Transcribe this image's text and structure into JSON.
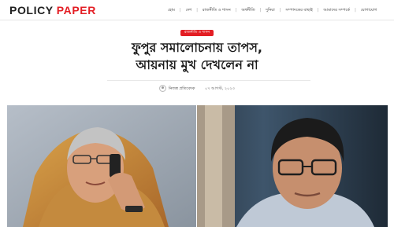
{
  "header": {
    "logo_part1": "POLICY",
    "logo_part2": "PAPER",
    "nav": [
      {
        "label": "হোম"
      },
      {
        "label": "দেশ"
      },
      {
        "label": "রাজনীতি ও শাসন"
      },
      {
        "label": "অর্থনীতি"
      },
      {
        "label": "দুনিয়া"
      },
      {
        "label": "সম্পাদকের বাছাই"
      },
      {
        "label": "আমাদের সম্পর্কে"
      },
      {
        "label": "যোগাযোগ"
      }
    ]
  },
  "article": {
    "category": "রাজনীতি ও শাসন",
    "title_line1": "ফুপুর সমালোচনায় তাপস,",
    "title_line2": "আয়নায় মুখ দেখলেন না",
    "author": "নিজস্ব প্রতিবেদক",
    "date": "০৭ আগস্ট, ২০২৩"
  },
  "images": {
    "left_icon": "photo-person-phone",
    "right_icon": "photo-person-glasses"
  },
  "colors": {
    "accent": "#e31e24",
    "text": "#1a1a1a"
  }
}
